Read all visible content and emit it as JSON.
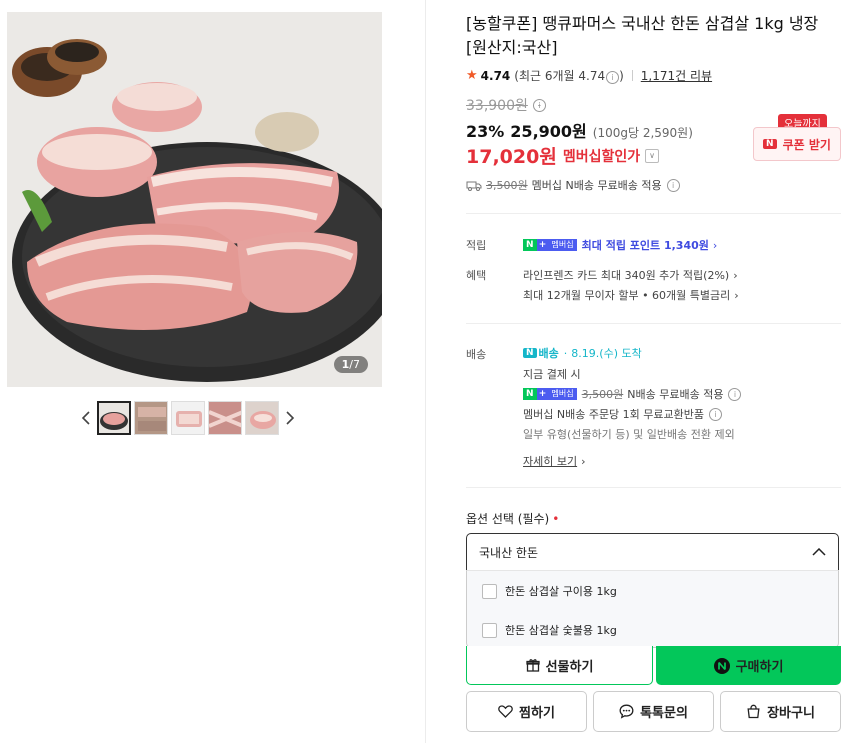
{
  "gallery": {
    "counter_current": "1",
    "counter_total": "/7",
    "thumb_count": 5
  },
  "product": {
    "title": "[농할쿠폰] 땡큐파머스 국내산 한돈 삼겹살 1kg 냉장 [원산지:국산]",
    "rating": "4.74",
    "recent_rating": "(최근 6개월 4.74",
    "recent_rating_end": ")",
    "review_count": "1,171건 리뷰",
    "original_price": "33,900원",
    "discount_pct": "23%",
    "sale_price": "25,900원",
    "unit_price": "(100g당 2,590원)",
    "member_price": "17,020원",
    "member_label": "멤버십할인가",
    "coupon_today": "오늘까지",
    "coupon_label": "쿠폰 받기",
    "shipping_old": "3,500원",
    "shipping_text": "멤버십 N배송 무료배송 적용"
  },
  "points": {
    "label": "적립",
    "badge_n": "N",
    "badge_plus": "+",
    "badge_member": "멤버십",
    "text": "최대 적립 포인트 1,340원"
  },
  "benefit": {
    "label": "혜택",
    "line1": "라인프렌즈 카드 최대 340원 추가 적립(2%)",
    "line2": "최대 12개월 무이자 할부 • 60개월 특별금리"
  },
  "delivery": {
    "label": "배송",
    "badge": "배송",
    "arrival": "8.19.(수) 도착",
    "pay_now": "지금 결제 시",
    "old_fee": "3,500원",
    "free_text": "N배송 무료배송 적용",
    "exchange": "멤버십 N배송 주문당 1회 무료교환반품",
    "note": "일부 유형(선물하기 등) 및 일반배송 전환 제외",
    "more": "자세히 보기"
  },
  "options": {
    "title": "옵션 선택 (필수)",
    "required_mark": "•",
    "selected": "국내산 한돈",
    "items": [
      "한돈 삼겹살 구이용 1kg",
      "한돈 삼겹살 숯불용 1kg"
    ]
  },
  "actions": {
    "gift": "선물하기",
    "buy": "구매하기",
    "wish": "찜하기",
    "inquiry": "톡톡문의",
    "cart": "장바구니"
  },
  "colors": {
    "accent_green": "#03c75a",
    "accent_red": "#e4303a",
    "member_blue": "#3f4be0",
    "delivery_teal": "#15b6c9"
  }
}
